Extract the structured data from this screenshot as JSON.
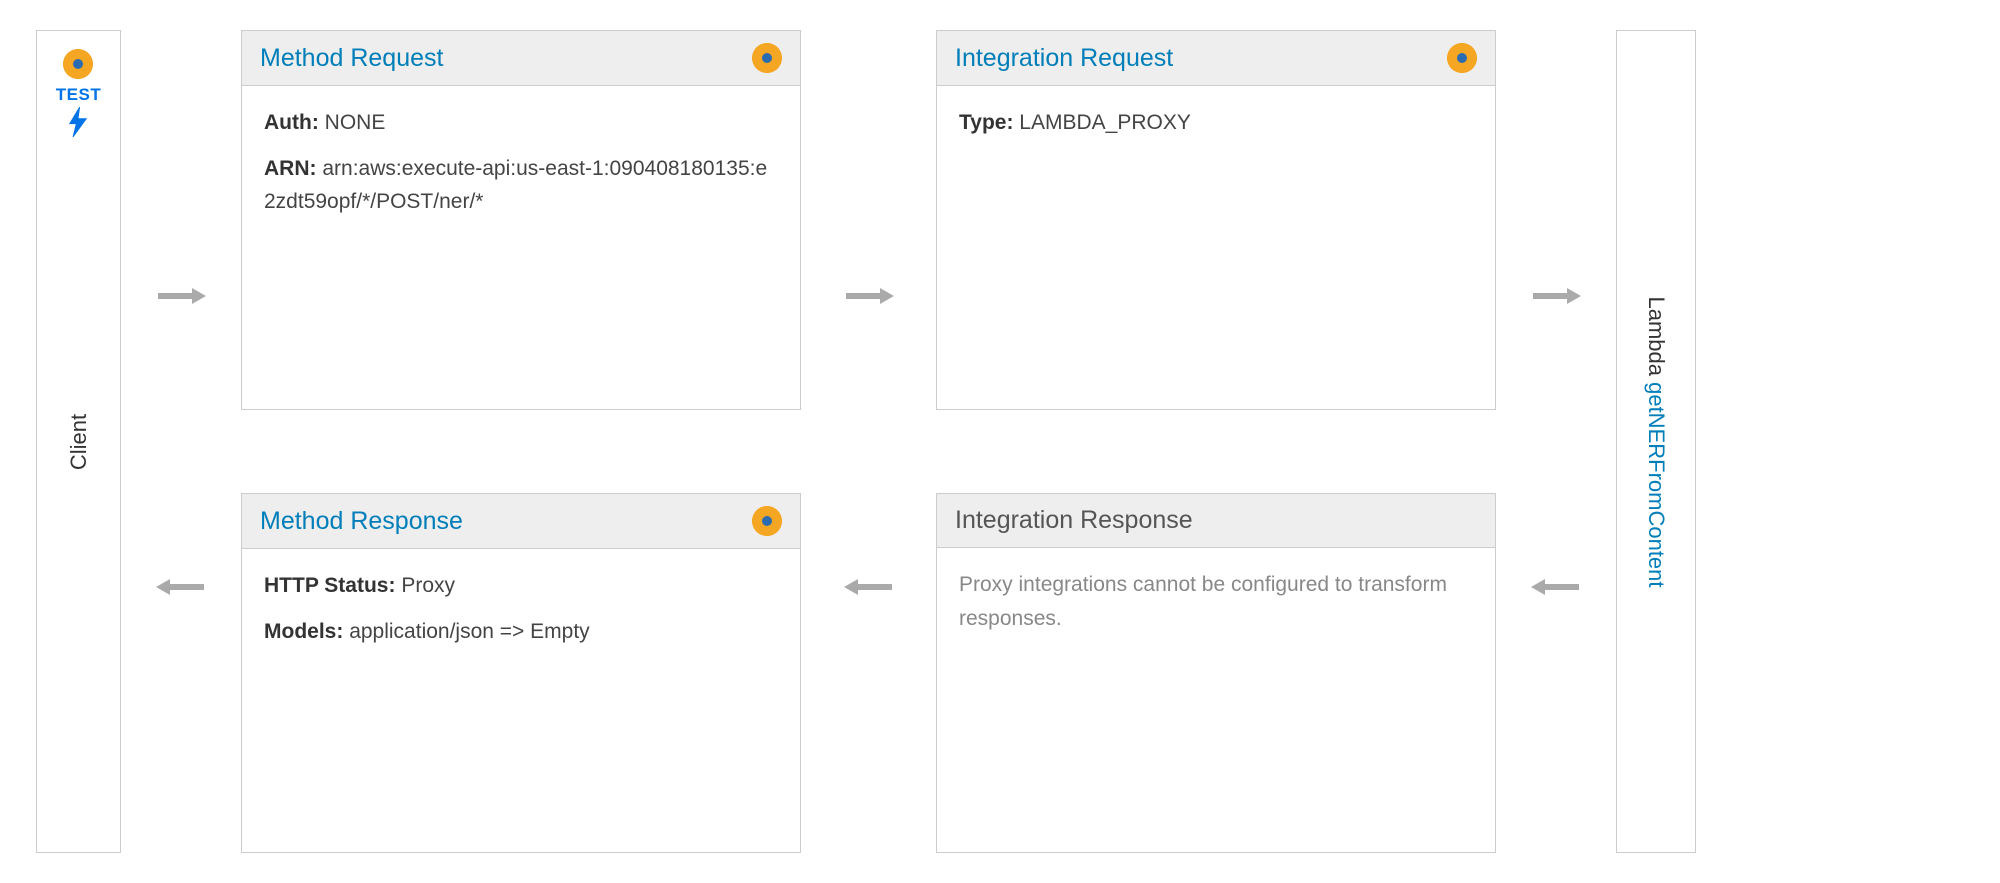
{
  "client": {
    "test_label": "TEST",
    "bolt_glyph": "⚡",
    "panel_label": "Client"
  },
  "lambda": {
    "panel_prefix": "Lambda ",
    "function_name": "getNERFromContent"
  },
  "cards": {
    "method_request": {
      "title": "Method Request",
      "auth_label": "Auth:",
      "auth_value": "NONE",
      "arn_label": "ARN:",
      "arn_value": "arn:aws:execute-api:us-east-1:090408180135:e2zdt59opf/*/POST/ner/*"
    },
    "integration_request": {
      "title": "Integration Request",
      "type_label": "Type:",
      "type_value": "LAMBDA_PROXY"
    },
    "method_response": {
      "title": "Method Response",
      "http_status_label": "HTTP Status:",
      "http_status_value": "Proxy",
      "models_label": "Models:",
      "models_value": "application/json => Empty"
    },
    "integration_response": {
      "title": "Integration Response",
      "message": "Proxy integrations cannot be configured to transform responses."
    }
  }
}
